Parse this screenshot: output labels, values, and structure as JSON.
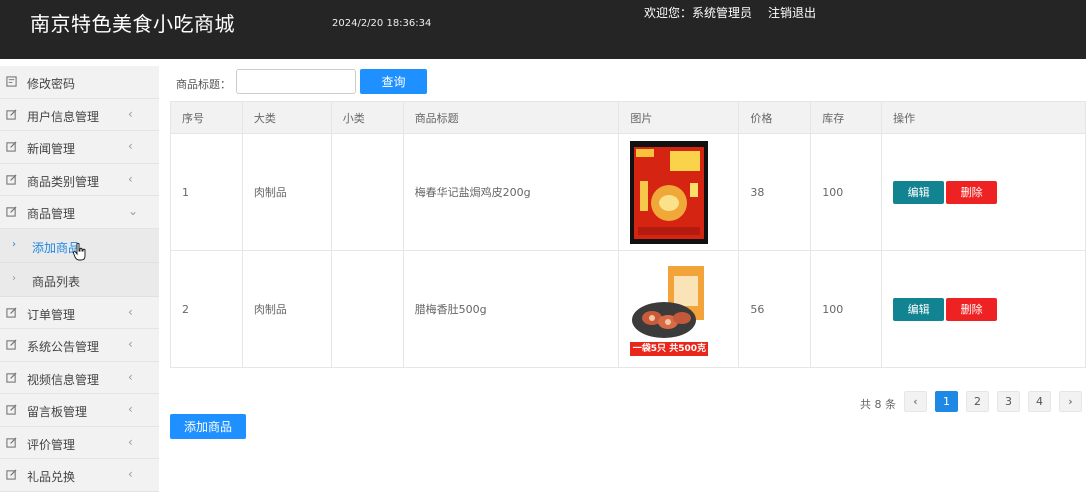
{
  "header": {
    "title": "南京特色美食小吃商城",
    "datetime": "2024/2/20 18:36:34",
    "welcome": "欢迎您：系统管理员",
    "logout": "注销退出"
  },
  "sidebar": {
    "items": [
      {
        "label": "修改密码",
        "icon": "doc-icon"
      },
      {
        "label": "用户信息管理",
        "icon": "edit-icon",
        "chev": "‹"
      },
      {
        "label": "新闻管理",
        "icon": "edit-icon",
        "chev": "‹"
      },
      {
        "label": "商品类别管理",
        "icon": "edit-icon",
        "chev": "‹"
      },
      {
        "label": "商品管理",
        "icon": "edit-icon",
        "chev": "⌄"
      }
    ],
    "subitems": [
      {
        "label": "添加商品",
        "active": true
      },
      {
        "label": "商品列表",
        "active": false
      }
    ],
    "items_after": [
      {
        "label": "订单管理",
        "chev": "‹"
      },
      {
        "label": "系统公告管理",
        "chev": "‹"
      },
      {
        "label": "视频信息管理",
        "chev": "‹"
      },
      {
        "label": "留言板管理",
        "chev": "‹"
      },
      {
        "label": "评价管理",
        "chev": "‹"
      },
      {
        "label": "礼品兑换",
        "chev": "‹"
      }
    ]
  },
  "search": {
    "label": "商品标题：",
    "value": "",
    "button": "查询"
  },
  "table": {
    "headers": [
      "序号",
      "大类",
      "小类",
      "商品标题",
      "图片",
      "价格",
      "库存",
      "操作"
    ],
    "rows": [
      {
        "no": "1",
        "category": "肉制品",
        "subcategory": "",
        "title": "梅春华记盐焗鸡皮200g",
        "price": "38",
        "stock": "100",
        "edit": "编辑",
        "delete": "删除"
      },
      {
        "no": "2",
        "category": "肉制品",
        "subcategory": "",
        "title": "腊梅香肚500g",
        "price": "56",
        "stock": "100",
        "edit": "编辑",
        "delete": "删除"
      }
    ],
    "image2_caption": "一袋5只 共500克"
  },
  "pagination": {
    "total": "共 8 条",
    "prev": "‹",
    "pages": [
      "1",
      "2",
      "3",
      "4"
    ],
    "active_page": "1",
    "next": "›"
  },
  "add_button": "添加商品",
  "colors": {
    "header_bg": "#252525",
    "primary": "#1e90ff",
    "edit": "#128390",
    "delete": "#ee2222"
  }
}
